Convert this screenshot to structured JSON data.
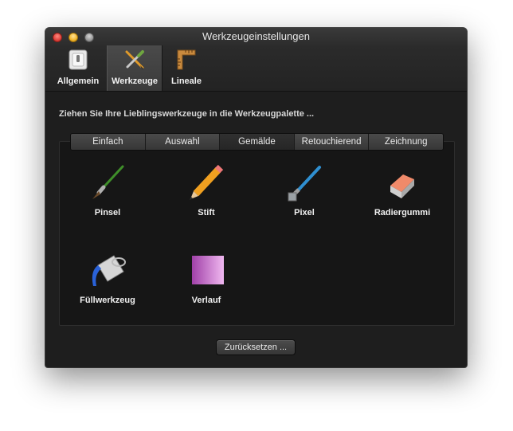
{
  "window": {
    "title": "Werkzeugeinstellungen"
  },
  "toolbar": {
    "items": [
      {
        "label": "Allgemein",
        "icon": "switch-icon"
      },
      {
        "label": "Werkzeuge",
        "icon": "tools-icon",
        "selected": true
      },
      {
        "label": "Lineale",
        "icon": "ruler-icon"
      }
    ]
  },
  "instruction": "Ziehen Sie Ihre Lieblingswerkzeuge in die Werkzeugpalette ...",
  "segments": {
    "items": [
      "Einfach",
      "Auswahl",
      "Gemälde",
      "Retouchierend",
      "Zeichnung"
    ],
    "selected": "Gemälde"
  },
  "tools": [
    {
      "label": "Pinsel",
      "icon": "paintbrush-icon"
    },
    {
      "label": "Stift",
      "icon": "pencil-icon"
    },
    {
      "label": "Pixel",
      "icon": "pixel-pen-icon"
    },
    {
      "label": "Radiergummi",
      "icon": "eraser-icon"
    },
    {
      "label": "Füllwerkzeug",
      "icon": "paint-bucket-icon"
    },
    {
      "label": "Verlauf",
      "icon": "gradient-icon"
    }
  ],
  "reset_button": "Zurücksetzen ...",
  "colors": {
    "window_bg": "#1e1e1e",
    "panel_bg": "#161616",
    "text": "#f0f0f0"
  }
}
